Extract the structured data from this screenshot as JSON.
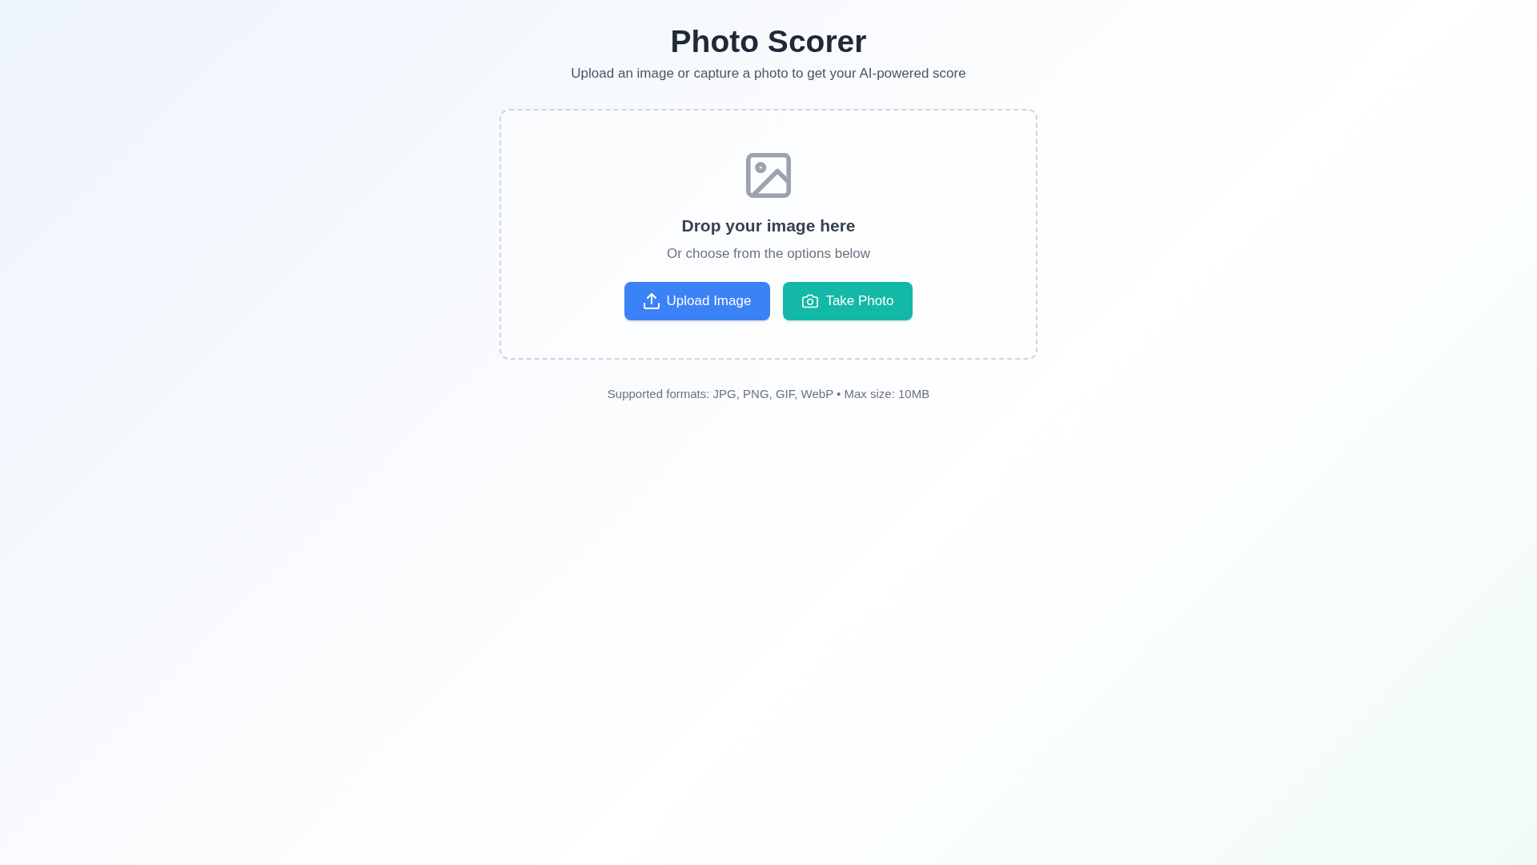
{
  "header": {
    "title": "Photo Scorer",
    "subtitle": "Upload an image or capture a photo to get your AI-powered score"
  },
  "drop_zone": {
    "heading": "Drop your image here",
    "hint": "Or choose from the options below",
    "buttons": [
      {
        "label": "Upload Image",
        "kind": "upload"
      },
      {
        "label": "Take Photo",
        "kind": "camera"
      }
    ]
  },
  "footer_note": "Supported formats: JPG, PNG, GIF, WebP • Max size: 10MB"
}
